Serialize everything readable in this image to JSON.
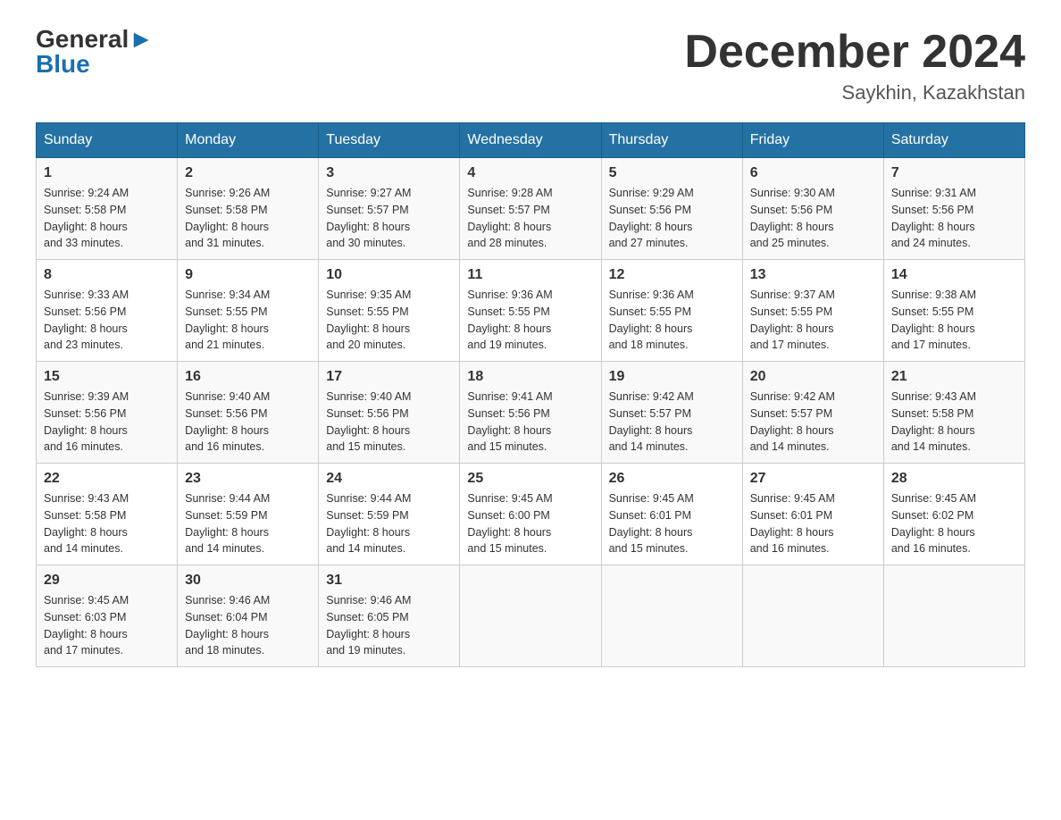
{
  "logo": {
    "general": "General",
    "blue": "Blue"
  },
  "title": "December 2024",
  "location": "Saykhin, Kazakhstan",
  "days_of_week": [
    "Sunday",
    "Monday",
    "Tuesday",
    "Wednesday",
    "Thursday",
    "Friday",
    "Saturday"
  ],
  "weeks": [
    [
      {
        "day": "1",
        "sunrise": "9:24 AM",
        "sunset": "5:58 PM",
        "daylight": "8 hours and 33 minutes."
      },
      {
        "day": "2",
        "sunrise": "9:26 AM",
        "sunset": "5:58 PM",
        "daylight": "8 hours and 31 minutes."
      },
      {
        "day": "3",
        "sunrise": "9:27 AM",
        "sunset": "5:57 PM",
        "daylight": "8 hours and 30 minutes."
      },
      {
        "day": "4",
        "sunrise": "9:28 AM",
        "sunset": "5:57 PM",
        "daylight": "8 hours and 28 minutes."
      },
      {
        "day": "5",
        "sunrise": "9:29 AM",
        "sunset": "5:56 PM",
        "daylight": "8 hours and 27 minutes."
      },
      {
        "day": "6",
        "sunrise": "9:30 AM",
        "sunset": "5:56 PM",
        "daylight": "8 hours and 25 minutes."
      },
      {
        "day": "7",
        "sunrise": "9:31 AM",
        "sunset": "5:56 PM",
        "daylight": "8 hours and 24 minutes."
      }
    ],
    [
      {
        "day": "8",
        "sunrise": "9:33 AM",
        "sunset": "5:56 PM",
        "daylight": "8 hours and 23 minutes."
      },
      {
        "day": "9",
        "sunrise": "9:34 AM",
        "sunset": "5:55 PM",
        "daylight": "8 hours and 21 minutes."
      },
      {
        "day": "10",
        "sunrise": "9:35 AM",
        "sunset": "5:55 PM",
        "daylight": "8 hours and 20 minutes."
      },
      {
        "day": "11",
        "sunrise": "9:36 AM",
        "sunset": "5:55 PM",
        "daylight": "8 hours and 19 minutes."
      },
      {
        "day": "12",
        "sunrise": "9:36 AM",
        "sunset": "5:55 PM",
        "daylight": "8 hours and 18 minutes."
      },
      {
        "day": "13",
        "sunrise": "9:37 AM",
        "sunset": "5:55 PM",
        "daylight": "8 hours and 17 minutes."
      },
      {
        "day": "14",
        "sunrise": "9:38 AM",
        "sunset": "5:55 PM",
        "daylight": "8 hours and 17 minutes."
      }
    ],
    [
      {
        "day": "15",
        "sunrise": "9:39 AM",
        "sunset": "5:56 PM",
        "daylight": "8 hours and 16 minutes."
      },
      {
        "day": "16",
        "sunrise": "9:40 AM",
        "sunset": "5:56 PM",
        "daylight": "8 hours and 16 minutes."
      },
      {
        "day": "17",
        "sunrise": "9:40 AM",
        "sunset": "5:56 PM",
        "daylight": "8 hours and 15 minutes."
      },
      {
        "day": "18",
        "sunrise": "9:41 AM",
        "sunset": "5:56 PM",
        "daylight": "8 hours and 15 minutes."
      },
      {
        "day": "19",
        "sunrise": "9:42 AM",
        "sunset": "5:57 PM",
        "daylight": "8 hours and 14 minutes."
      },
      {
        "day": "20",
        "sunrise": "9:42 AM",
        "sunset": "5:57 PM",
        "daylight": "8 hours and 14 minutes."
      },
      {
        "day": "21",
        "sunrise": "9:43 AM",
        "sunset": "5:58 PM",
        "daylight": "8 hours and 14 minutes."
      }
    ],
    [
      {
        "day": "22",
        "sunrise": "9:43 AM",
        "sunset": "5:58 PM",
        "daylight": "8 hours and 14 minutes."
      },
      {
        "day": "23",
        "sunrise": "9:44 AM",
        "sunset": "5:59 PM",
        "daylight": "8 hours and 14 minutes."
      },
      {
        "day": "24",
        "sunrise": "9:44 AM",
        "sunset": "5:59 PM",
        "daylight": "8 hours and 14 minutes."
      },
      {
        "day": "25",
        "sunrise": "9:45 AM",
        "sunset": "6:00 PM",
        "daylight": "8 hours and 15 minutes."
      },
      {
        "day": "26",
        "sunrise": "9:45 AM",
        "sunset": "6:01 PM",
        "daylight": "8 hours and 15 minutes."
      },
      {
        "day": "27",
        "sunrise": "9:45 AM",
        "sunset": "6:01 PM",
        "daylight": "8 hours and 16 minutes."
      },
      {
        "day": "28",
        "sunrise": "9:45 AM",
        "sunset": "6:02 PM",
        "daylight": "8 hours and 16 minutes."
      }
    ],
    [
      {
        "day": "29",
        "sunrise": "9:45 AM",
        "sunset": "6:03 PM",
        "daylight": "8 hours and 17 minutes."
      },
      {
        "day": "30",
        "sunrise": "9:46 AM",
        "sunset": "6:04 PM",
        "daylight": "8 hours and 18 minutes."
      },
      {
        "day": "31",
        "sunrise": "9:46 AM",
        "sunset": "6:05 PM",
        "daylight": "8 hours and 19 minutes."
      },
      null,
      null,
      null,
      null
    ]
  ],
  "labels": {
    "sunrise": "Sunrise:",
    "sunset": "Sunset:",
    "daylight": "Daylight:"
  }
}
